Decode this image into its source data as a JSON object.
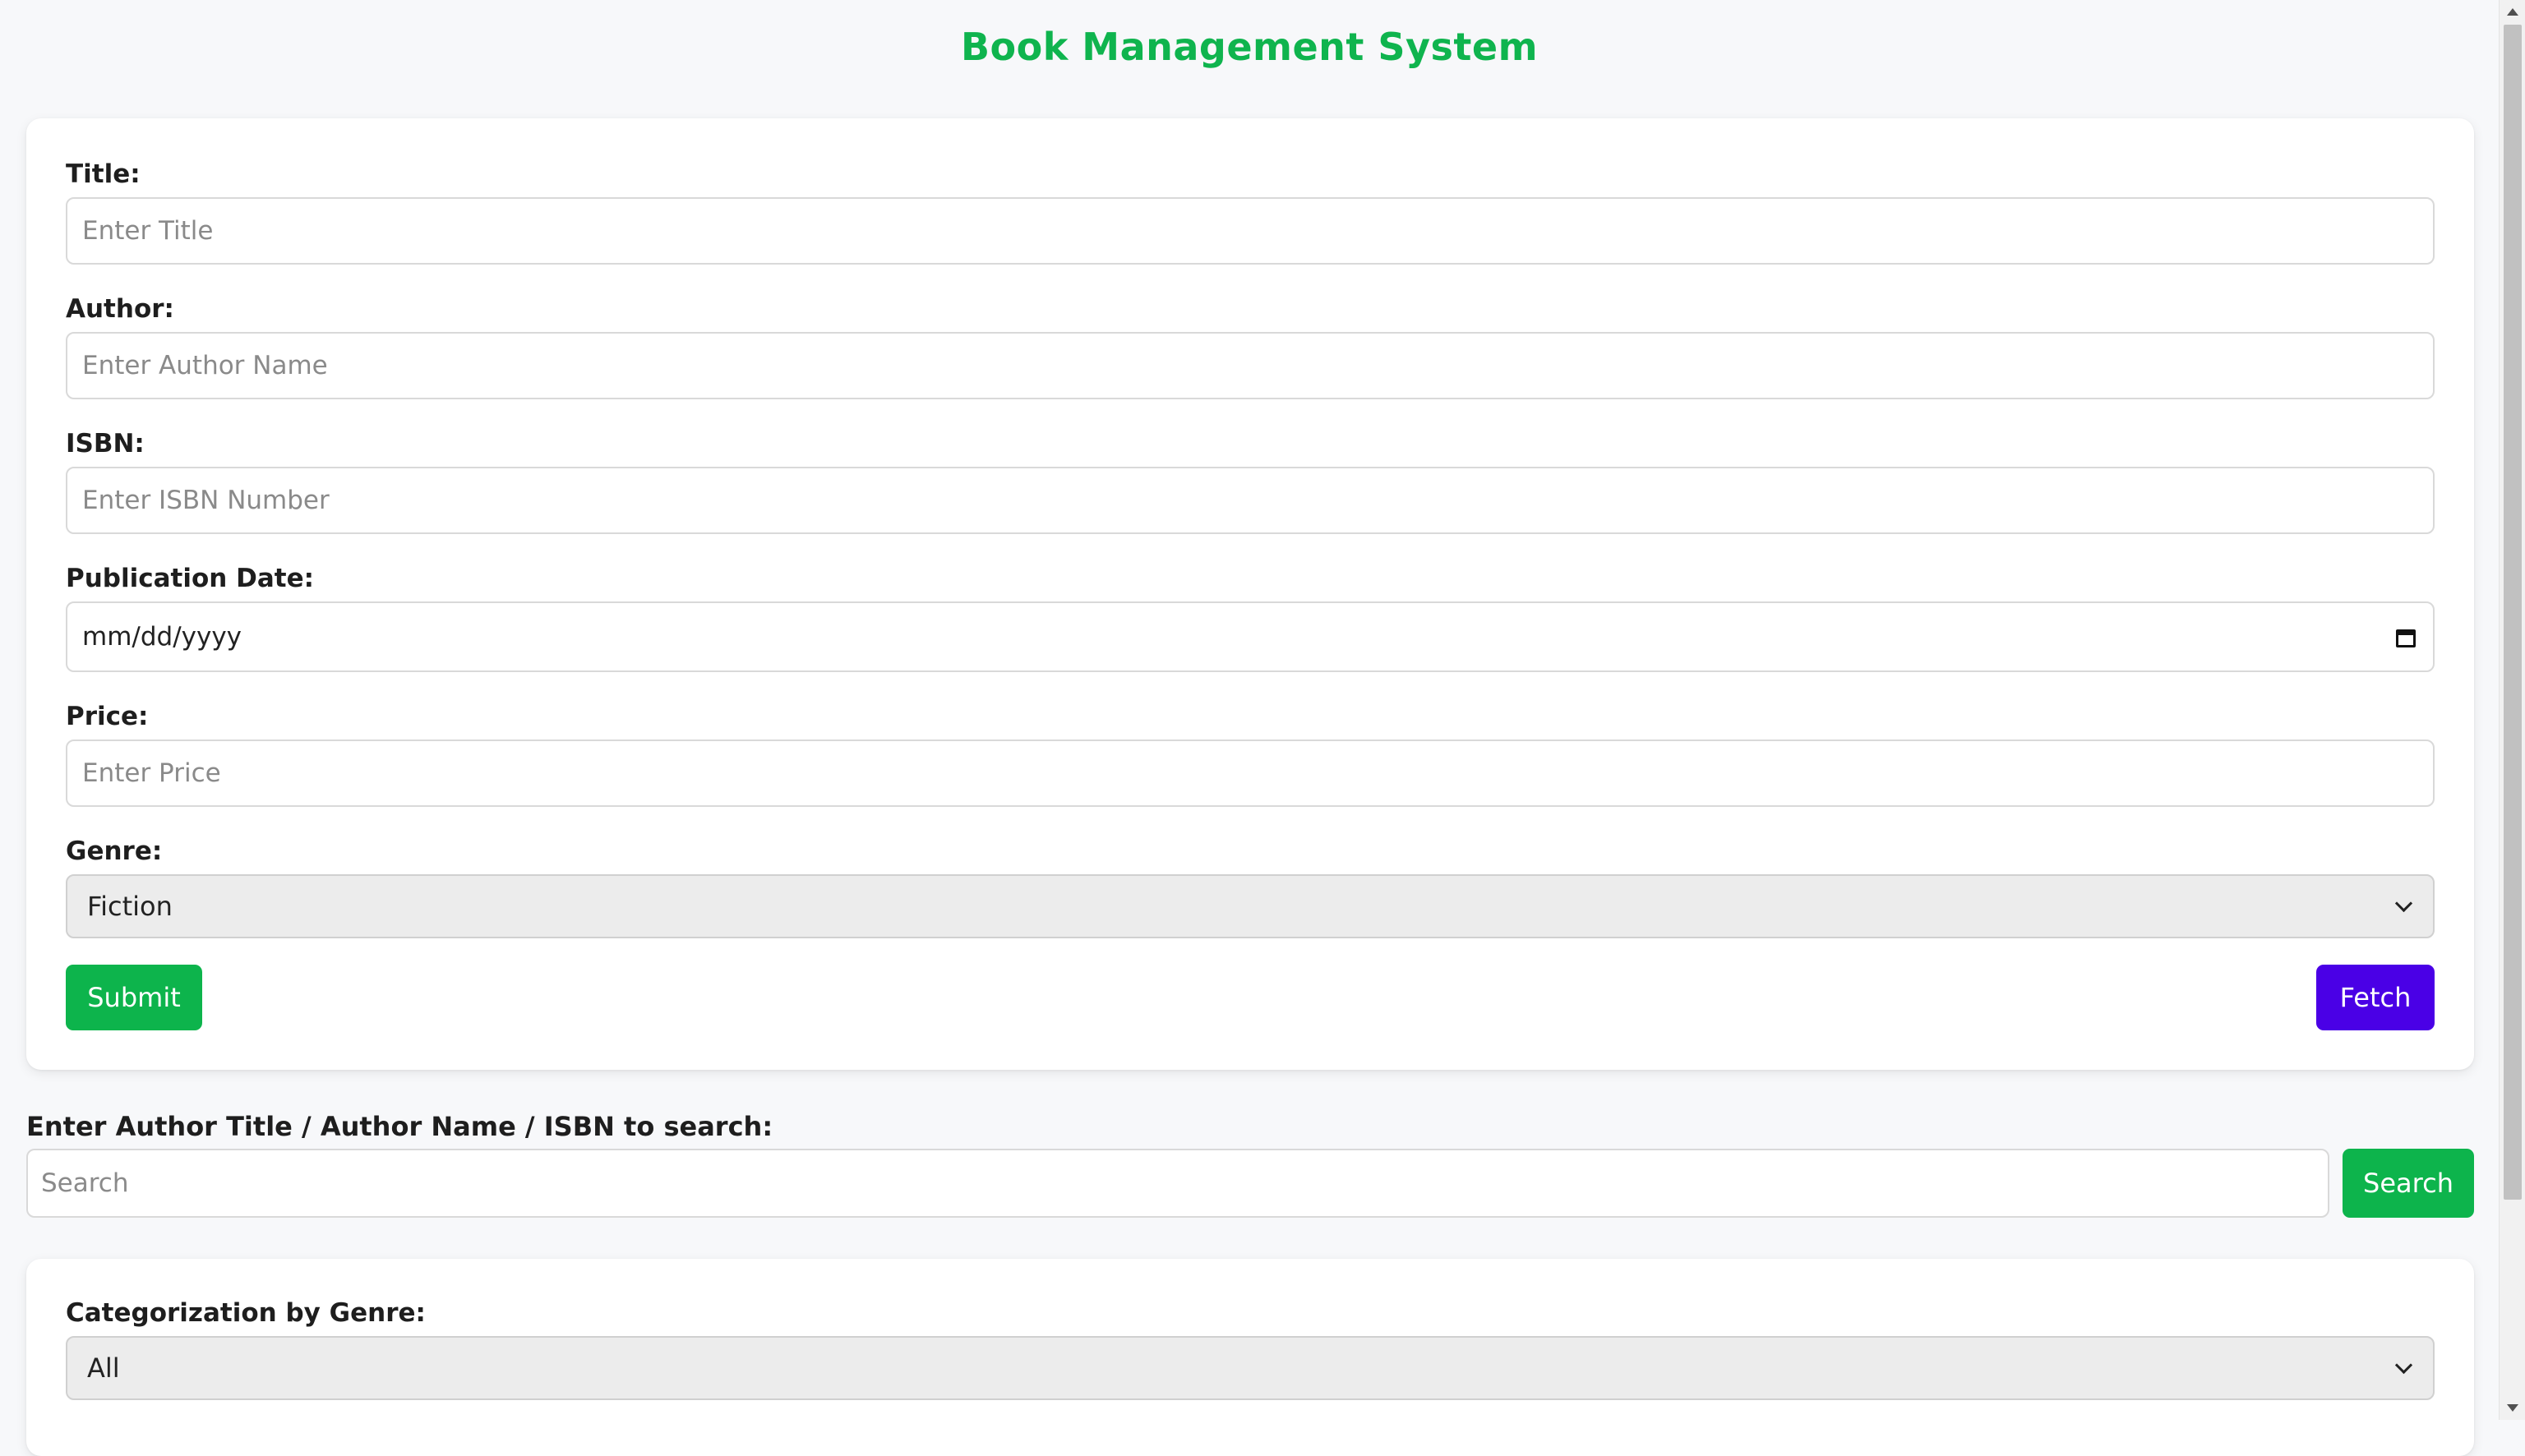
{
  "app": {
    "title": "Book Management System"
  },
  "form": {
    "title_label": "Title:",
    "title_placeholder": "Enter Title",
    "author_label": "Author:",
    "author_placeholder": "Enter Author Name",
    "isbn_label": "ISBN:",
    "isbn_placeholder": "Enter ISBN Number",
    "date_label": "Publication Date:",
    "date_value": "mm/dd/yyyy",
    "price_label": "Price:",
    "price_placeholder": "Enter Price",
    "genre_label": "Genre:",
    "genre_selected": "Fiction",
    "submit_label": "Submit",
    "fetch_label": "Fetch"
  },
  "search": {
    "label": "Enter Author Title / Author Name / ISBN to search:",
    "placeholder": "Search",
    "button_label": "Search"
  },
  "categorization": {
    "label": "Categorization by Genre:",
    "selected": "All"
  },
  "colors": {
    "title": "#0fb44e",
    "submit": "#0db44c",
    "fetch": "#4a00e6",
    "search": "#0db44c"
  },
  "icons": {
    "calendar": "calendar-icon",
    "dropdown": "chevron-down-icon"
  }
}
